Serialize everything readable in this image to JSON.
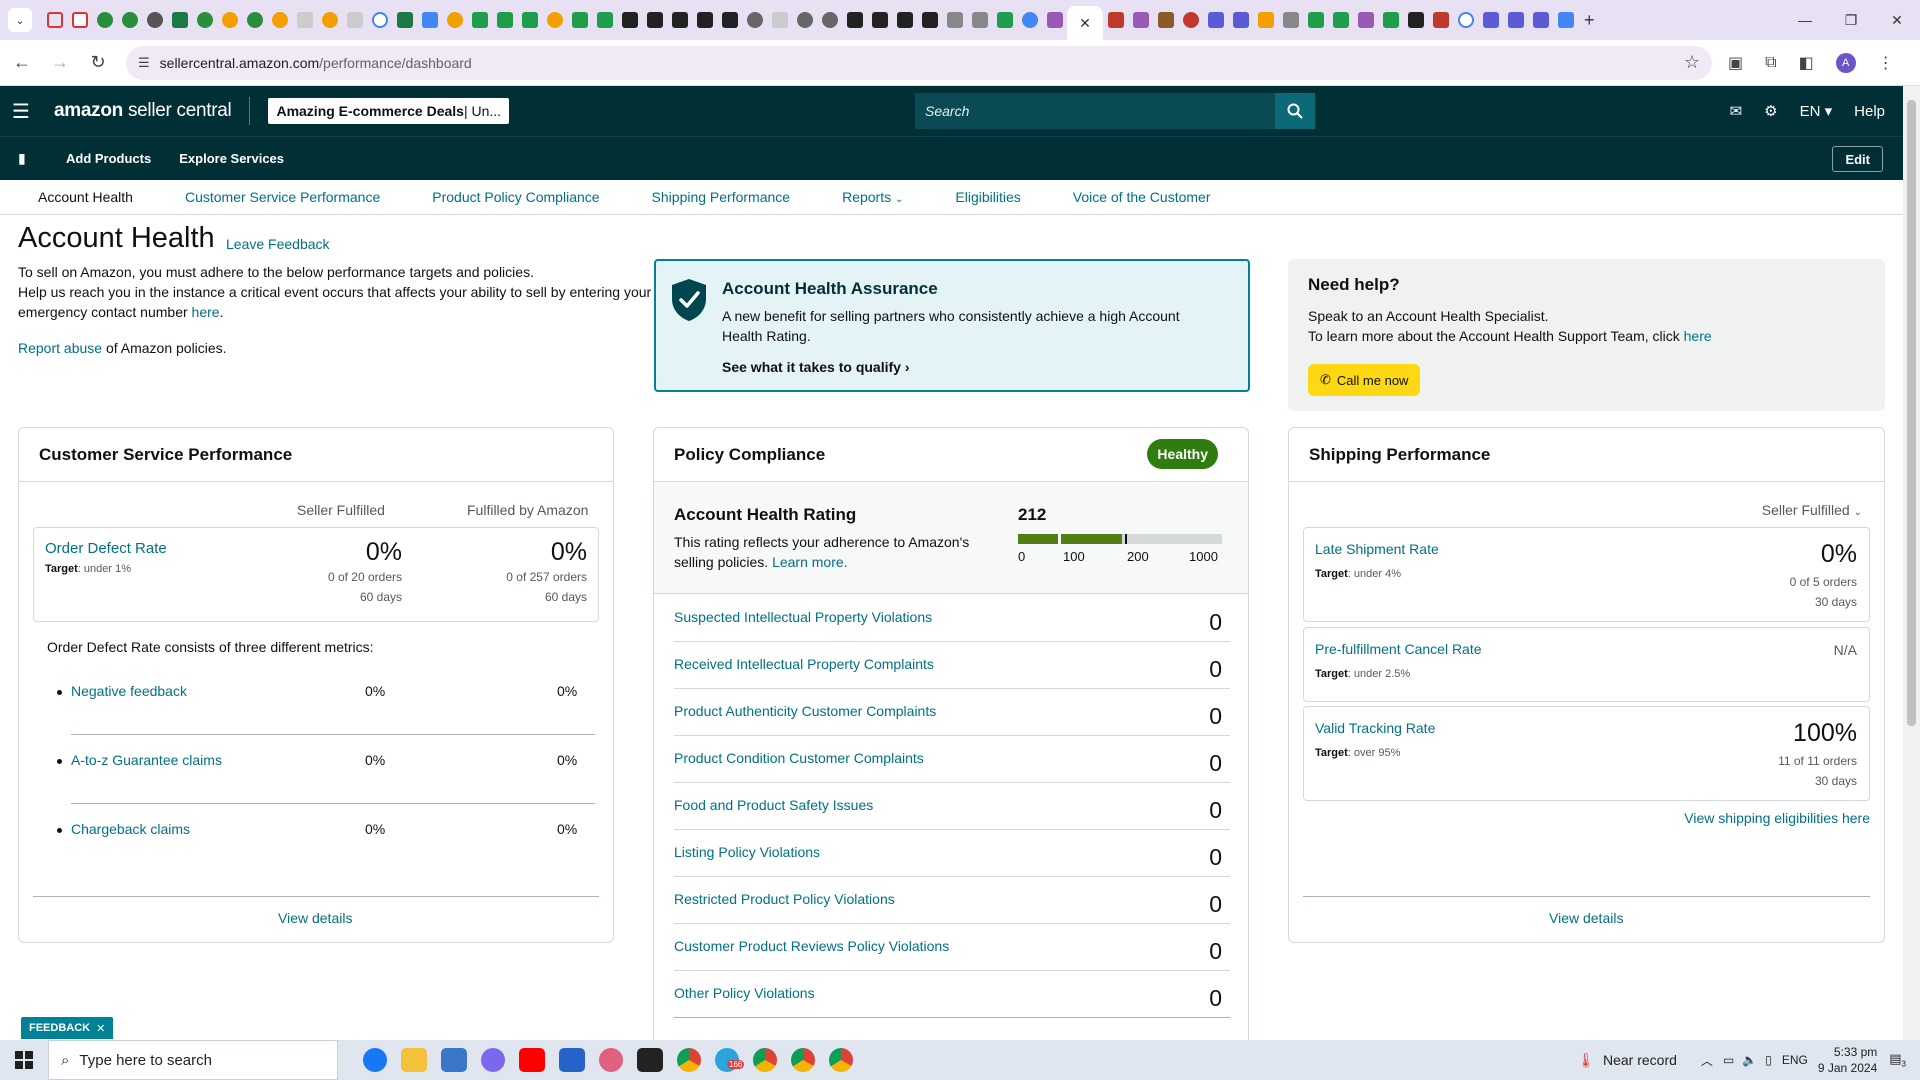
{
  "browser": {
    "tab_close": "✕",
    "new_tab": "+",
    "url_host": "sellercentral.amazon.com",
    "url_path": "/performance/dashboard",
    "window_controls": [
      "—",
      "❐",
      "✕"
    ]
  },
  "header": {
    "logo_bold": "amazon",
    "logo_light": "seller central",
    "store_bold": "Amazing E-commerce Deals",
    "store_rest": " | Un...",
    "search_placeholder": "Search",
    "language": "EN",
    "help": "Help"
  },
  "subnav": {
    "links": [
      "Add Products",
      "Explore Services"
    ],
    "edit": "Edit"
  },
  "tabs": [
    {
      "label": "Account Health"
    },
    {
      "label": "Customer Service Performance"
    },
    {
      "label": "Product Policy Compliance"
    },
    {
      "label": "Shipping Performance"
    },
    {
      "label": "Reports"
    },
    {
      "label": "Eligibilities"
    },
    {
      "label": "Voice of the Customer"
    }
  ],
  "page": {
    "title": "Account Health",
    "leave_feedback": "Leave Feedback",
    "intro_1": "To sell on Amazon, you must adhere to the below performance targets and policies.",
    "intro_2": "Help us reach you in the instance a critical event occurs that affects your ability to sell by entering your emergency contact number ",
    "intro_link": "here",
    "intro_end": ".",
    "report_link": "Report abuse",
    "report_rest": " of Amazon policies."
  },
  "assurance": {
    "title": "Account Health Assurance",
    "desc": "A new benefit for selling partners who consistently achieve a high Account Health Rating.",
    "link": "See what it takes to qualify"
  },
  "help": {
    "title": "Need help?",
    "line1": "Speak to an Account Health Specialist.",
    "line2": "To learn more about the Account Health Support Team, click ",
    "line2_link": "here",
    "call": "Call me now"
  },
  "customer_service": {
    "title": "Customer Service Performance",
    "col1": "Seller Fulfilled",
    "col2": "Fulfilled by Amazon",
    "odr_title": "Order Defect Rate",
    "odr_target_label": "Target",
    "odr_target": ": under 1%",
    "sf_value": "0%",
    "sf_orders": "0 of 20 orders",
    "sf_days": "60 days",
    "fba_value": "0%",
    "fba_orders": "0 of 257 orders",
    "fba_days": "60 days",
    "note": "Order Defect Rate consists of three different metrics:",
    "metrics": [
      {
        "label": "Negative feedback",
        "sf": "0%",
        "fba": "0%"
      },
      {
        "label": "A-to-z Guarantee claims",
        "sf": "0%",
        "fba": "0%"
      },
      {
        "label": "Chargeback claims",
        "sf": "0%",
        "fba": "0%"
      }
    ],
    "view_details": "View details"
  },
  "policy": {
    "title": "Policy Compliance",
    "badge": "Healthy",
    "ahr_title": "Account Health Rating",
    "ahr_desc": "This rating reflects your adherence to Amazon's selling policies. ",
    "ahr_link": "Learn more.",
    "score": "212",
    "scale": [
      "0",
      "100",
      "200",
      "1000"
    ],
    "violations": [
      {
        "label": "Suspected Intellectual Property Violations",
        "count": "0"
      },
      {
        "label": "Received Intellectual Property Complaints",
        "count": "0"
      },
      {
        "label": "Product Authenticity Customer Complaints",
        "count": "0"
      },
      {
        "label": "Product Condition Customer Complaints",
        "count": "0"
      },
      {
        "label": "Food and Product Safety Issues",
        "count": "0"
      },
      {
        "label": "Listing Policy Violations",
        "count": "0"
      },
      {
        "label": "Restricted Product Policy Violations",
        "count": "0"
      },
      {
        "label": "Customer Product Reviews Policy Violations",
        "count": "0"
      },
      {
        "label": "Other Policy Violations",
        "count": "0"
      }
    ]
  },
  "shipping": {
    "title": "Shipping Performance",
    "selector": "Seller Fulfilled",
    "late_title": "Late Shipment Rate",
    "late_target": ": under 4%",
    "late_value": "0%",
    "late_orders": "0 of 5 orders",
    "late_days": "30 days",
    "cancel_title": "Pre-fulfillment Cancel Rate",
    "cancel_target": ": under 2.5%",
    "cancel_value": "N/A",
    "vtr_title": "Valid Tracking Rate",
    "vtr_target": ": over 95%",
    "vtr_value": "100%",
    "vtr_orders": "11 of 11 orders",
    "vtr_days": "30 days",
    "target_label": "Target",
    "eligibility_link": "View shipping eligibilities here",
    "view_details": "View details"
  },
  "feedback_tag": "FEEDBACK",
  "taskbar": {
    "search": "Type here to search",
    "weather": "Near record",
    "lang": "ENG",
    "time": "5:33 pm",
    "date": "9 Jan 2024",
    "badge": "166",
    "notif": "3"
  }
}
